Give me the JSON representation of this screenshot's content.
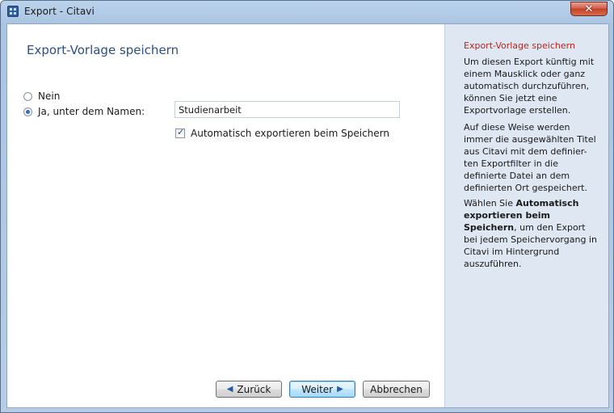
{
  "window": {
    "title": "Export - Citavi",
    "close_symbol": "✕"
  },
  "main": {
    "page_title": "Export-Vorlage speichern",
    "radio_nein_label": "Nein",
    "radio_ja_label": "Ja, unter dem Namen:",
    "selected_option": "Ja, unter dem Namen:",
    "name_value": "Studienarbeit",
    "auto_export_label": "Automatisch exportieren beim Speichern",
    "auto_export_checked": true
  },
  "buttons": {
    "back_label": "Zurück",
    "next_label": "Weiter",
    "cancel_label": "Abbrechen"
  },
  "help": {
    "heading": "Export-Vorlage speichern",
    "p1": "Um diesen Export künftig mit einem Mausklick oder ganz automatisch durchzuführen, können Sie jetzt eine Exportvorlage erstellen.",
    "p2": "Auf diese Weise werden immer die ausgewählten Titel aus Citavi mit dem definier-ten Exportfilter in die definierte Datei an dem definierten Ort gespeichert.",
    "p3_prefix": "Wählen Sie ",
    "p3_bold": "Automatisch exportieren beim Speichern",
    "p3_suffix": ", um den Export bei jedem Speichervorgang in Citavi im Hintergrund auszuführen."
  },
  "colors": {
    "heading_blue": "#2b4f86",
    "help_red": "#b7261c",
    "help_panel_bg": "#dfe7f3"
  },
  "icons": {
    "app": "citavi-app-icon",
    "close": "close-icon",
    "back": "arrow-left-icon",
    "next": "arrow-right-icon",
    "checkmark": "checkmark-icon"
  }
}
